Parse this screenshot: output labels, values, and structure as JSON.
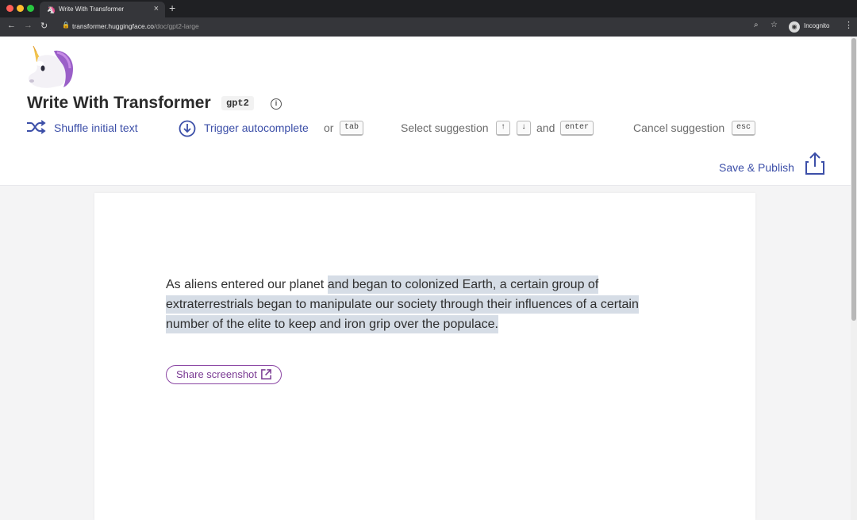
{
  "browser": {
    "tab_title": "Write With Transformer",
    "tab_close": "×",
    "new_tab": "+",
    "url_host": "transformer.huggingface.co",
    "url_path": "/doc/gpt2-large",
    "incognito_label": "Incognito"
  },
  "header": {
    "title": "Write With Transformer",
    "model": "gpt2",
    "shuffle_label": "Shuffle initial text",
    "trigger_label": "Trigger autocomplete",
    "or_text": "or",
    "tab_key": "tab",
    "select_label": "Select suggestion",
    "up_key": "↑",
    "down_key": "↓",
    "and_text": "and",
    "enter_key": "enter",
    "cancel_label": "Cancel suggestion",
    "esc_key": "esc",
    "save_label": "Save & Publish"
  },
  "document": {
    "prompt_text": "As aliens entered our planet ",
    "suggestion_text": " and began to colonized Earth, a certain group of extraterrestrials began to manipulate our society through their influences of a certain number of the elite to keep and iron grip over the populace.",
    "share_label": "Share screenshot"
  },
  "colors": {
    "accent": "#3c4fa8",
    "share_accent": "#8a45a3",
    "suggestion_highlight": "#d6dde6"
  },
  "icons": [
    "unicorn-logo",
    "shuffle-icon",
    "download-circle-icon",
    "info-icon",
    "upload-share-icon",
    "external-link-icon"
  ]
}
